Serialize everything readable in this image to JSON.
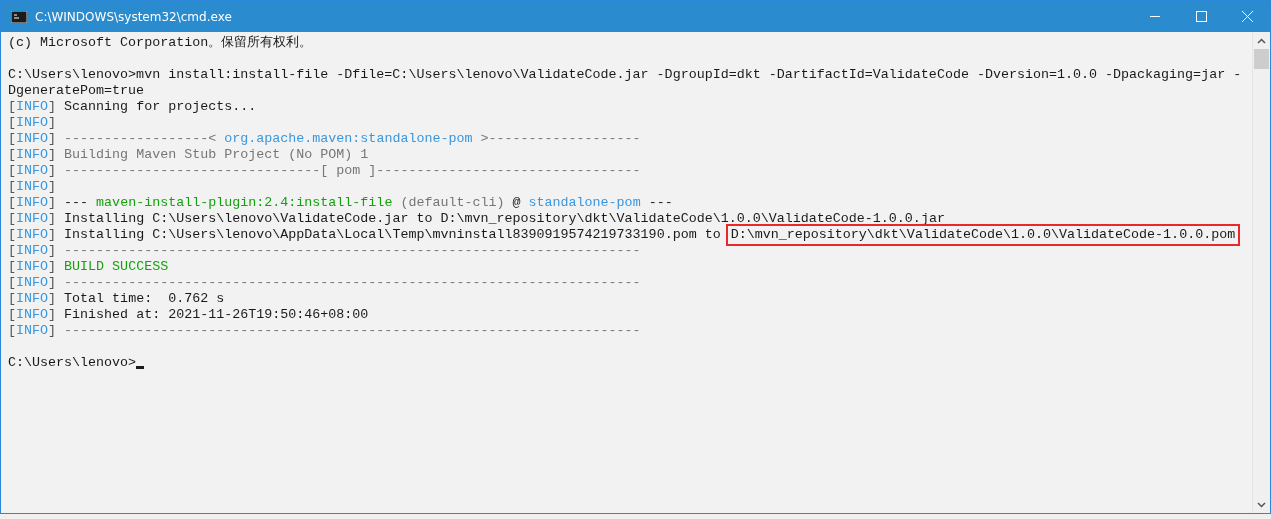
{
  "window": {
    "title": "C:\\WINDOWS\\system32\\cmd.exe"
  },
  "lines": [
    {
      "kind": "text",
      "segments": [
        {
          "kind": "plain",
          "text": "(c) Microsoft Corporation。保留所有权利。"
        }
      ]
    },
    {
      "kind": "blank"
    },
    {
      "kind": "text",
      "segments": [
        {
          "kind": "plain",
          "text": "C:\\Users\\lenovo>mvn install:install-file -Dfile=C:\\Users\\lenovo\\ValidateCode.jar -DgroupId=dkt -DartifactId=ValidateCode -Dversion=1.0.0 -Dpackaging=jar -"
        }
      ]
    },
    {
      "kind": "text",
      "segments": [
        {
          "kind": "plain",
          "text": "DgeneratePom=true"
        }
      ]
    },
    {
      "kind": "text",
      "segments": [
        {
          "kind": "tag",
          "text": "[INFO]"
        },
        {
          "kind": "plain",
          "text": " Scanning for projects..."
        }
      ]
    },
    {
      "kind": "text",
      "segments": [
        {
          "kind": "tag",
          "text": "[INFO]"
        }
      ]
    },
    {
      "kind": "text",
      "segments": [
        {
          "kind": "tag",
          "text": "[INFO]"
        },
        {
          "kind": "gray",
          "text": " ------------------< "
        },
        {
          "kind": "link",
          "text": "org.apache.maven:standalone-pom"
        },
        {
          "kind": "gray",
          "text": " >-------------------"
        }
      ]
    },
    {
      "kind": "text",
      "segments": [
        {
          "kind": "tag",
          "text": "[INFO]"
        },
        {
          "kind": "gray",
          "text": " Building Maven Stub Project (No POM) 1"
        }
      ]
    },
    {
      "kind": "text",
      "segments": [
        {
          "kind": "tag",
          "text": "[INFO]"
        },
        {
          "kind": "gray",
          "text": " --------------------------------[ pom ]---------------------------------"
        }
      ]
    },
    {
      "kind": "text",
      "segments": [
        {
          "kind": "tag",
          "text": "[INFO]"
        }
      ]
    },
    {
      "kind": "text",
      "segments": [
        {
          "kind": "tag",
          "text": "[INFO]"
        },
        {
          "kind": "plain",
          "text": " --- "
        },
        {
          "kind": "green",
          "text": "maven-install-plugin:2.4:install-file"
        },
        {
          "kind": "gray",
          "text": " (default-cli)"
        },
        {
          "kind": "plain",
          "text": " @ "
        },
        {
          "kind": "link",
          "text": "standalone-pom"
        },
        {
          "kind": "plain",
          "text": " ---"
        }
      ]
    },
    {
      "kind": "text",
      "segments": [
        {
          "kind": "tag",
          "text": "[INFO]"
        },
        {
          "kind": "plain",
          "text": " Installing C:\\Users\\lenovo\\ValidateCode.jar to D:\\mvn_repository\\dkt\\ValidateCode\\1.0.0\\ValidateCode-1.0.0.jar"
        }
      ]
    },
    {
      "kind": "text",
      "segments": [
        {
          "kind": "tag",
          "text": "[INFO]"
        },
        {
          "kind": "plain",
          "text": " Installing C:\\Users\\lenovo\\AppData\\Local\\Temp\\mvninstall8390919574219733190.pom to "
        },
        {
          "kind": "highlight",
          "text": "D:\\mvn_repository\\dkt\\ValidateCode\\1.0.0\\ValidateCode-1.0.0.pom"
        }
      ]
    },
    {
      "kind": "text",
      "segments": [
        {
          "kind": "tag",
          "text": "[INFO]"
        },
        {
          "kind": "gray",
          "text": " ------------------------------------------------------------------------"
        }
      ]
    },
    {
      "kind": "text",
      "segments": [
        {
          "kind": "tag",
          "text": "[INFO]"
        },
        {
          "kind": "green",
          "text": " BUILD SUCCESS"
        }
      ]
    },
    {
      "kind": "text",
      "segments": [
        {
          "kind": "tag",
          "text": "[INFO]"
        },
        {
          "kind": "gray",
          "text": " ------------------------------------------------------------------------"
        }
      ]
    },
    {
      "kind": "text",
      "segments": [
        {
          "kind": "tag",
          "text": "[INFO]"
        },
        {
          "kind": "plain",
          "text": " Total time:  0.762 s"
        }
      ]
    },
    {
      "kind": "text",
      "segments": [
        {
          "kind": "tag",
          "text": "[INFO]"
        },
        {
          "kind": "plain",
          "text": " Finished at: 2021-11-26T19:50:46+08:00"
        }
      ]
    },
    {
      "kind": "text",
      "segments": [
        {
          "kind": "tag",
          "text": "[INFO]"
        },
        {
          "kind": "gray",
          "text": " ------------------------------------------------------------------------"
        }
      ]
    },
    {
      "kind": "blank"
    },
    {
      "kind": "text",
      "cursor": true,
      "segments": [
        {
          "kind": "plain",
          "text": "C:\\Users\\lenovo>"
        }
      ]
    }
  ]
}
